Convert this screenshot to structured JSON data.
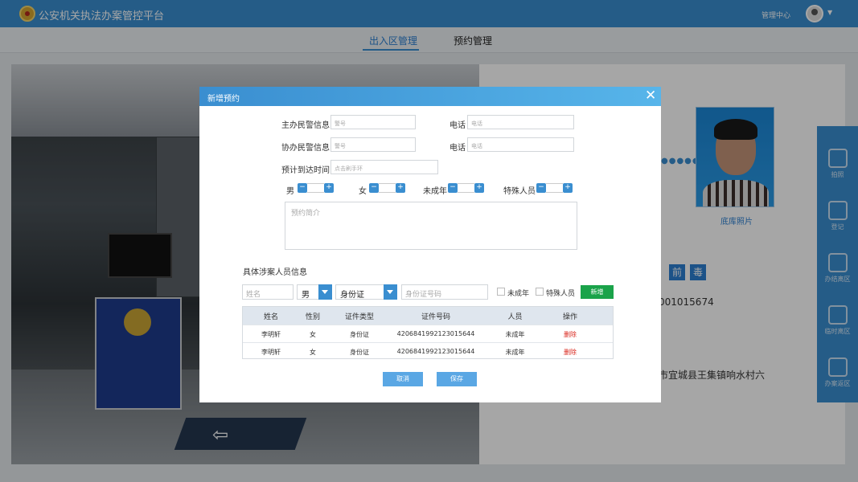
{
  "app": {
    "title": "公安机关执法办案管控平台",
    "mgmt_center": "管理中心"
  },
  "tabs": [
    {
      "label": "出入区管理",
      "active": true
    },
    {
      "label": "预约管理",
      "active": false
    }
  ],
  "right_panel": {
    "photo_caption": "底库照片",
    "buttons": [
      "前",
      "毒"
    ],
    "id_fragment": "001015674",
    "address_fragment": "市宜城县王集镇响水村六"
  },
  "side_nav": [
    {
      "label": "拍照",
      "icon": "camera-icon"
    },
    {
      "label": "登记",
      "icon": "edit-icon"
    },
    {
      "label": "办结离区",
      "icon": "person-icon"
    },
    {
      "label": "临时离区",
      "icon": "house-up-icon"
    },
    {
      "label": "办案返区",
      "icon": "house-return-icon"
    }
  ],
  "modal": {
    "title": "新增预约",
    "main_officer_label": "主办民警信息",
    "main_officer_placeholder": "警号",
    "phone_label": "电话",
    "phone_placeholder": "电话",
    "assist_officer_label": "协办民警信息",
    "assist_officer_placeholder": "警号",
    "phone2_label": "电话",
    "phone2_placeholder": "电话",
    "arrival_label": "预计到达时间",
    "arrival_placeholder": "点击刷手环",
    "counters": [
      {
        "label": "男",
        "minus": "−",
        "plus": "+"
      },
      {
        "label": "女",
        "minus": "−",
        "plus": "+"
      },
      {
        "label": "未成年",
        "minus": "−",
        "plus": "+"
      },
      {
        "label": "特殊人员",
        "minus": "−",
        "plus": "+"
      }
    ],
    "summary_placeholder": "预约简介",
    "section_title": "具体涉案人员信息",
    "name_placeholder": "姓名",
    "gender_value": "男",
    "id_type_value": "身份证",
    "id_no_placeholder": "身份证号码",
    "minor_label": "未成年",
    "special_label": "特殊人员",
    "add_button": "新增",
    "table": {
      "headers": [
        "姓名",
        "性别",
        "证件类型",
        "证件号码",
        "人员",
        "操作"
      ],
      "rows": [
        {
          "name": "李明轩",
          "gender": "女",
          "id_type": "身份证",
          "id_no": "4206841992123015644",
          "category": "未成年",
          "action": "删除"
        },
        {
          "name": "李明轩",
          "gender": "女",
          "id_type": "身份证",
          "id_no": "4206841992123015644",
          "category": "未成年",
          "action": "删除"
        }
      ]
    },
    "cancel_button": "取消",
    "save_button": "保存",
    "close_glyph": "✕"
  },
  "colors": {
    "primary": "#3a8ed0",
    "add_green": "#1aa34a",
    "delete_red": "#d9261c"
  }
}
